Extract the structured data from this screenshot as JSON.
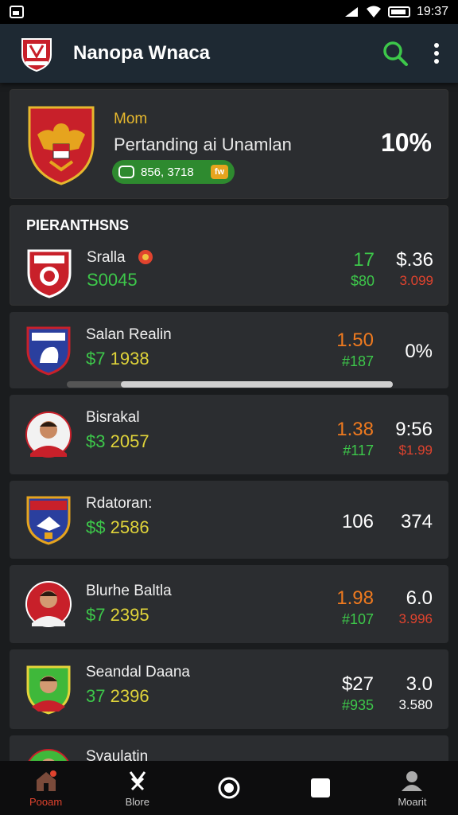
{
  "status_bar": {
    "time": "19:37"
  },
  "app_bar": {
    "title": "Nanopa Wnaca",
    "logo": "club-crest-logo",
    "search_icon": "search-icon",
    "menu_icon": "more-vert-icon"
  },
  "hero": {
    "kicker": "Mom",
    "match": "Pertanding ai Unamlan",
    "pill_value": "856, 3718",
    "pill_tag": "fw",
    "percent": "10%"
  },
  "section": {
    "title": "PIERANTHSNS"
  },
  "rows": [
    {
      "name": "Sralla",
      "sub_green": "S0045",
      "sub_yellow": "",
      "c1": "17",
      "c1_color": "green",
      "c1_sub": "$80",
      "c2": "$.36",
      "c2_color": "green",
      "c2_sub": "3.099"
    },
    {
      "name": "Salan Realin",
      "sub_green": "$7",
      "sub_yellow": "1938",
      "c1": "1.50",
      "c1_color": "orange",
      "c1_sub": "#187",
      "c2": "0%",
      "c2_color": "white",
      "c2_sub": ""
    },
    {
      "name": "Bisrakal",
      "sub_green": "$3",
      "sub_yellow": "2057",
      "c1": "1.38",
      "c1_color": "orange",
      "c1_sub": "#117",
      "c2": "9:56",
      "c2_color": "white",
      "c2_sub": "$1.99"
    },
    {
      "name": "Rdatoran:",
      "sub_green": "$$",
      "sub_yellow": "2586",
      "c1": "106",
      "c1_color": "white",
      "c1_sub": "",
      "c2": "374",
      "c2_color": "white",
      "c2_sub": ""
    },
    {
      "name": "Blurhe Baltla",
      "sub_green": "$7",
      "sub_yellow": "2395",
      "c1": "1.98",
      "c1_color": "orange",
      "c1_sub": "#107",
      "c2": "6.0",
      "c2_color": "white",
      "c2_sub": "3.996"
    },
    {
      "name": "Seandal Daana",
      "sub_green": "37",
      "sub_yellow": "2396",
      "c1": "$27",
      "c1_color": "white",
      "c1_sub": "#935",
      "c2": "3.0",
      "c2_color": "white",
      "c2_sub": "3.580"
    },
    {
      "name": "Syaulatin",
      "sub_green": "",
      "sub_yellow": "",
      "c1": "",
      "c1_color": "orange",
      "c1_sub": "",
      "c2": "",
      "c2_color": "white",
      "c2_sub": ""
    }
  ],
  "nav": [
    {
      "label": "Pooam",
      "icon": "home-icon",
      "active": true
    },
    {
      "label": "Blore",
      "icon": "tools-icon",
      "active": false
    },
    {
      "label": "",
      "icon": "circle-icon",
      "active": false
    },
    {
      "label": "",
      "icon": "square-icon",
      "active": false
    },
    {
      "label": "Moarit",
      "icon": "profile-icon",
      "active": false
    }
  ]
}
